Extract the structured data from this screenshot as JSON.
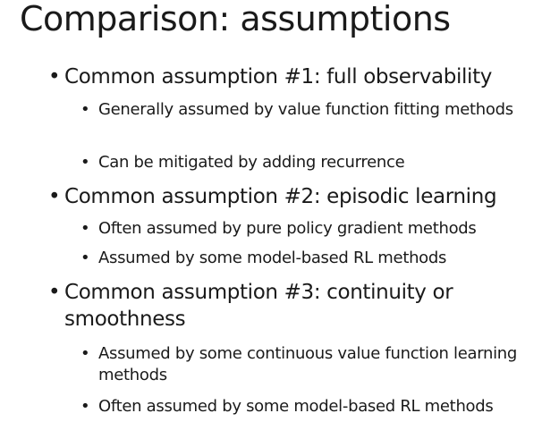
{
  "slide": {
    "title": "Comparison: assumptions",
    "bullets": [
      {
        "text": "Common assumption #1: full observability",
        "sub": [
          "Generally assumed by value function fitting methods",
          "Can be mitigated by adding recurrence"
        ]
      },
      {
        "text": "Common assumption #2: episodic learning",
        "sub": [
          "Often assumed by pure policy gradient methods",
          "Assumed by some model-based RL methods"
        ]
      },
      {
        "text": "Common assumption #3: continuity or smoothness",
        "sub": [
          "Assumed by some continuous value function learning methods",
          "Often assumed by some model-based RL methods"
        ]
      }
    ]
  }
}
